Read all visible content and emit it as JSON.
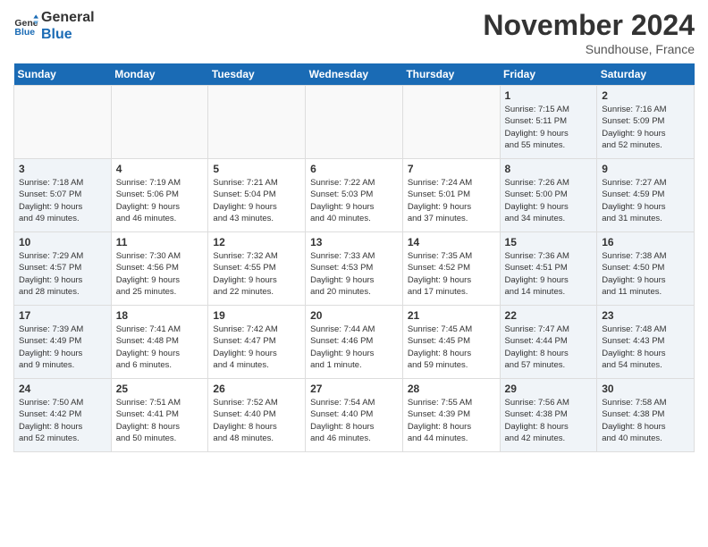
{
  "header": {
    "logo_line1": "General",
    "logo_line2": "Blue",
    "month": "November 2024",
    "location": "Sundhouse, France"
  },
  "days_of_week": [
    "Sunday",
    "Monday",
    "Tuesday",
    "Wednesday",
    "Thursday",
    "Friday",
    "Saturday"
  ],
  "weeks": [
    [
      {
        "day": "",
        "info": "",
        "type": "empty"
      },
      {
        "day": "",
        "info": "",
        "type": "empty"
      },
      {
        "day": "",
        "info": "",
        "type": "empty"
      },
      {
        "day": "",
        "info": "",
        "type": "empty"
      },
      {
        "day": "",
        "info": "",
        "type": "empty"
      },
      {
        "day": "1",
        "info": "Sunrise: 7:15 AM\nSunset: 5:11 PM\nDaylight: 9 hours\nand 55 minutes.",
        "type": "weekend"
      },
      {
        "day": "2",
        "info": "Sunrise: 7:16 AM\nSunset: 5:09 PM\nDaylight: 9 hours\nand 52 minutes.",
        "type": "weekend"
      }
    ],
    [
      {
        "day": "3",
        "info": "Sunrise: 7:18 AM\nSunset: 5:07 PM\nDaylight: 9 hours\nand 49 minutes.",
        "type": "weekend"
      },
      {
        "day": "4",
        "info": "Sunrise: 7:19 AM\nSunset: 5:06 PM\nDaylight: 9 hours\nand 46 minutes.",
        "type": "weekday"
      },
      {
        "day": "5",
        "info": "Sunrise: 7:21 AM\nSunset: 5:04 PM\nDaylight: 9 hours\nand 43 minutes.",
        "type": "weekday"
      },
      {
        "day": "6",
        "info": "Sunrise: 7:22 AM\nSunset: 5:03 PM\nDaylight: 9 hours\nand 40 minutes.",
        "type": "weekday"
      },
      {
        "day": "7",
        "info": "Sunrise: 7:24 AM\nSunset: 5:01 PM\nDaylight: 9 hours\nand 37 minutes.",
        "type": "weekday"
      },
      {
        "day": "8",
        "info": "Sunrise: 7:26 AM\nSunset: 5:00 PM\nDaylight: 9 hours\nand 34 minutes.",
        "type": "weekend"
      },
      {
        "day": "9",
        "info": "Sunrise: 7:27 AM\nSunset: 4:59 PM\nDaylight: 9 hours\nand 31 minutes.",
        "type": "weekend"
      }
    ],
    [
      {
        "day": "10",
        "info": "Sunrise: 7:29 AM\nSunset: 4:57 PM\nDaylight: 9 hours\nand 28 minutes.",
        "type": "weekend"
      },
      {
        "day": "11",
        "info": "Sunrise: 7:30 AM\nSunset: 4:56 PM\nDaylight: 9 hours\nand 25 minutes.",
        "type": "weekday"
      },
      {
        "day": "12",
        "info": "Sunrise: 7:32 AM\nSunset: 4:55 PM\nDaylight: 9 hours\nand 22 minutes.",
        "type": "weekday"
      },
      {
        "day": "13",
        "info": "Sunrise: 7:33 AM\nSunset: 4:53 PM\nDaylight: 9 hours\nand 20 minutes.",
        "type": "weekday"
      },
      {
        "day": "14",
        "info": "Sunrise: 7:35 AM\nSunset: 4:52 PM\nDaylight: 9 hours\nand 17 minutes.",
        "type": "weekday"
      },
      {
        "day": "15",
        "info": "Sunrise: 7:36 AM\nSunset: 4:51 PM\nDaylight: 9 hours\nand 14 minutes.",
        "type": "weekend"
      },
      {
        "day": "16",
        "info": "Sunrise: 7:38 AM\nSunset: 4:50 PM\nDaylight: 9 hours\nand 11 minutes.",
        "type": "weekend"
      }
    ],
    [
      {
        "day": "17",
        "info": "Sunrise: 7:39 AM\nSunset: 4:49 PM\nDaylight: 9 hours\nand 9 minutes.",
        "type": "weekend"
      },
      {
        "day": "18",
        "info": "Sunrise: 7:41 AM\nSunset: 4:48 PM\nDaylight: 9 hours\nand 6 minutes.",
        "type": "weekday"
      },
      {
        "day": "19",
        "info": "Sunrise: 7:42 AM\nSunset: 4:47 PM\nDaylight: 9 hours\nand 4 minutes.",
        "type": "weekday"
      },
      {
        "day": "20",
        "info": "Sunrise: 7:44 AM\nSunset: 4:46 PM\nDaylight: 9 hours\nand 1 minute.",
        "type": "weekday"
      },
      {
        "day": "21",
        "info": "Sunrise: 7:45 AM\nSunset: 4:45 PM\nDaylight: 8 hours\nand 59 minutes.",
        "type": "weekday"
      },
      {
        "day": "22",
        "info": "Sunrise: 7:47 AM\nSunset: 4:44 PM\nDaylight: 8 hours\nand 57 minutes.",
        "type": "weekend"
      },
      {
        "day": "23",
        "info": "Sunrise: 7:48 AM\nSunset: 4:43 PM\nDaylight: 8 hours\nand 54 minutes.",
        "type": "weekend"
      }
    ],
    [
      {
        "day": "24",
        "info": "Sunrise: 7:50 AM\nSunset: 4:42 PM\nDaylight: 8 hours\nand 52 minutes.",
        "type": "weekend"
      },
      {
        "day": "25",
        "info": "Sunrise: 7:51 AM\nSunset: 4:41 PM\nDaylight: 8 hours\nand 50 minutes.",
        "type": "weekday"
      },
      {
        "day": "26",
        "info": "Sunrise: 7:52 AM\nSunset: 4:40 PM\nDaylight: 8 hours\nand 48 minutes.",
        "type": "weekday"
      },
      {
        "day": "27",
        "info": "Sunrise: 7:54 AM\nSunset: 4:40 PM\nDaylight: 8 hours\nand 46 minutes.",
        "type": "weekday"
      },
      {
        "day": "28",
        "info": "Sunrise: 7:55 AM\nSunset: 4:39 PM\nDaylight: 8 hours\nand 44 minutes.",
        "type": "weekday"
      },
      {
        "day": "29",
        "info": "Sunrise: 7:56 AM\nSunset: 4:38 PM\nDaylight: 8 hours\nand 42 minutes.",
        "type": "weekend"
      },
      {
        "day": "30",
        "info": "Sunrise: 7:58 AM\nSunset: 4:38 PM\nDaylight: 8 hours\nand 40 minutes.",
        "type": "weekend"
      }
    ]
  ]
}
